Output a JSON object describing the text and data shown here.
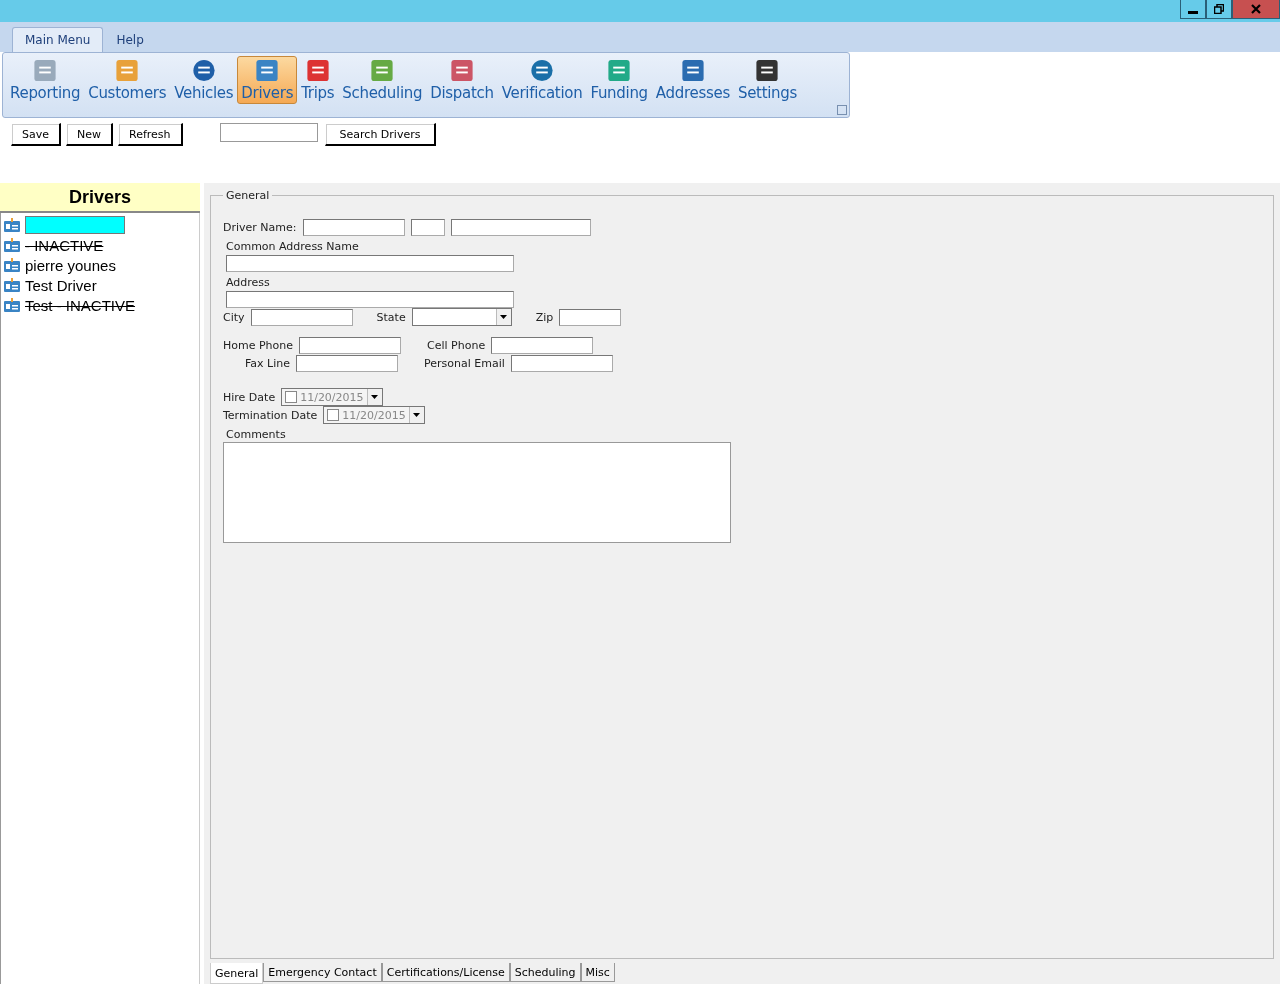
{
  "menu_tabs": [
    {
      "label": "Main Menu",
      "selected": true
    },
    {
      "label": "Help",
      "selected": false
    }
  ],
  "ribbon": [
    {
      "label": "Reporting",
      "selected": false
    },
    {
      "label": "Customers",
      "selected": false
    },
    {
      "label": "Vehicles",
      "selected": false
    },
    {
      "label": "Drivers",
      "selected": true
    },
    {
      "label": "Trips",
      "selected": false
    },
    {
      "label": "Scheduling",
      "selected": false
    },
    {
      "label": "Dispatch",
      "selected": false
    },
    {
      "label": "Verification",
      "selected": false
    },
    {
      "label": "Funding",
      "selected": false
    },
    {
      "label": "Addresses",
      "selected": false
    },
    {
      "label": "Settings",
      "selected": false
    }
  ],
  "toolbar": {
    "buttons": [
      "Save",
      "New",
      "Refresh"
    ],
    "search_button": "Search Drivers"
  },
  "sidebar": {
    "title": "Drivers",
    "items": [
      {
        "selected": true,
        "inactive": false
      },
      {
        "label": "- INACTIVE",
        "selected": false,
        "inactive": true
      },
      {
        "label": "pierre younes",
        "selected": false,
        "inactive": false
      },
      {
        "label": "Test Driver",
        "selected": false,
        "inactive": false
      },
      {
        "label": "Test - INACTIVE",
        "selected": false,
        "inactive": true
      }
    ]
  },
  "form": {
    "group_title": "General",
    "rows": [
      [
        {
          "kind": "label",
          "text": "Driver Name:"
        },
        {
          "kind": "text"
        },
        {
          "kind": "text"
        },
        {
          "kind": "text"
        }
      ],
      [
        {
          "kind": "caption",
          "text": "Common Address Name"
        }
      ],
      [
        {
          "kind": "text"
        }
      ],
      [
        {
          "kind": "caption",
          "text": "Address"
        }
      ],
      [
        {
          "kind": "text"
        }
      ],
      [
        {
          "kind": "label",
          "text": "City"
        },
        {
          "kind": "text"
        },
        {
          "kind": "label",
          "text": "State"
        },
        {
          "kind": "select"
        },
        {
          "kind": "label",
          "text": "Zip"
        },
        {
          "kind": "text"
        }
      ],
      [
        {
          "kind": "label",
          "text": "Home Phone"
        },
        {
          "kind": "text"
        },
        {
          "kind": "label",
          "text": "Cell Phone"
        },
        {
          "kind": "text"
        }
      ],
      [
        {
          "kind": "label",
          "text": "Fax Line"
        },
        {
          "kind": "text"
        },
        {
          "kind": "label",
          "text": "Personal Email"
        },
        {
          "kind": "text"
        }
      ],
      [
        {
          "kind": "label",
          "text": "Hire Date"
        },
        {
          "kind": "date",
          "value": "11/20/2015",
          "checked": false
        }
      ],
      [
        {
          "kind": "label",
          "text": "Termination Date"
        },
        {
          "kind": "date",
          "value": "11/20/2015",
          "checked": false
        }
      ],
      [
        {
          "kind": "caption",
          "text": "Comments"
        }
      ],
      [
        {
          "kind": "area"
        }
      ]
    ]
  },
  "bottom_tabs": [
    {
      "label": "General",
      "selected": true
    },
    {
      "label": "Emergency Contact",
      "selected": false
    },
    {
      "label": "Certifications/License",
      "selected": false
    },
    {
      "label": "Scheduling",
      "selected": false
    },
    {
      "label": "Misc",
      "selected": false
    }
  ]
}
